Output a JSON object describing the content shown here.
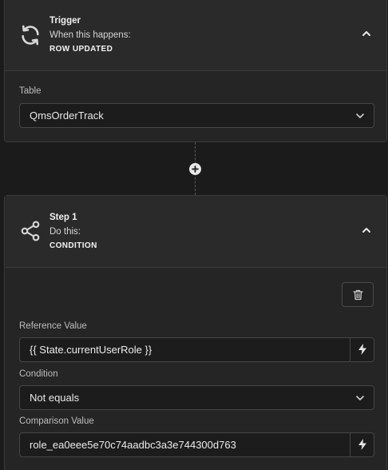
{
  "trigger": {
    "title": "Trigger",
    "subtitle": "When this happens:",
    "action": "ROW UPDATED",
    "table_label": "Table",
    "table_value": "QmsOrderTrack"
  },
  "step": {
    "title": "Step 1",
    "subtitle": "Do this:",
    "action": "CONDITION",
    "reference_label": "Reference Value",
    "reference_value": "{{ State.currentUserRole }}",
    "condition_label": "Condition",
    "condition_value": "Not equals",
    "comparison_label": "Comparison Value",
    "comparison_value": "role_ea0eee5e70c74aadbc3a3e744300d763"
  },
  "icons": {
    "trigger": "refresh-icon",
    "step": "share-icon",
    "collapse": "chevron-up-icon",
    "dropdown": "chevron-down-icon",
    "add": "plus-circle-icon",
    "delete": "trash-icon",
    "binding": "lightning-icon"
  },
  "colors": {
    "background": "#1b1b1b",
    "card": "#252525",
    "border": "#3a3a3a",
    "text": "#e2e2e2"
  }
}
